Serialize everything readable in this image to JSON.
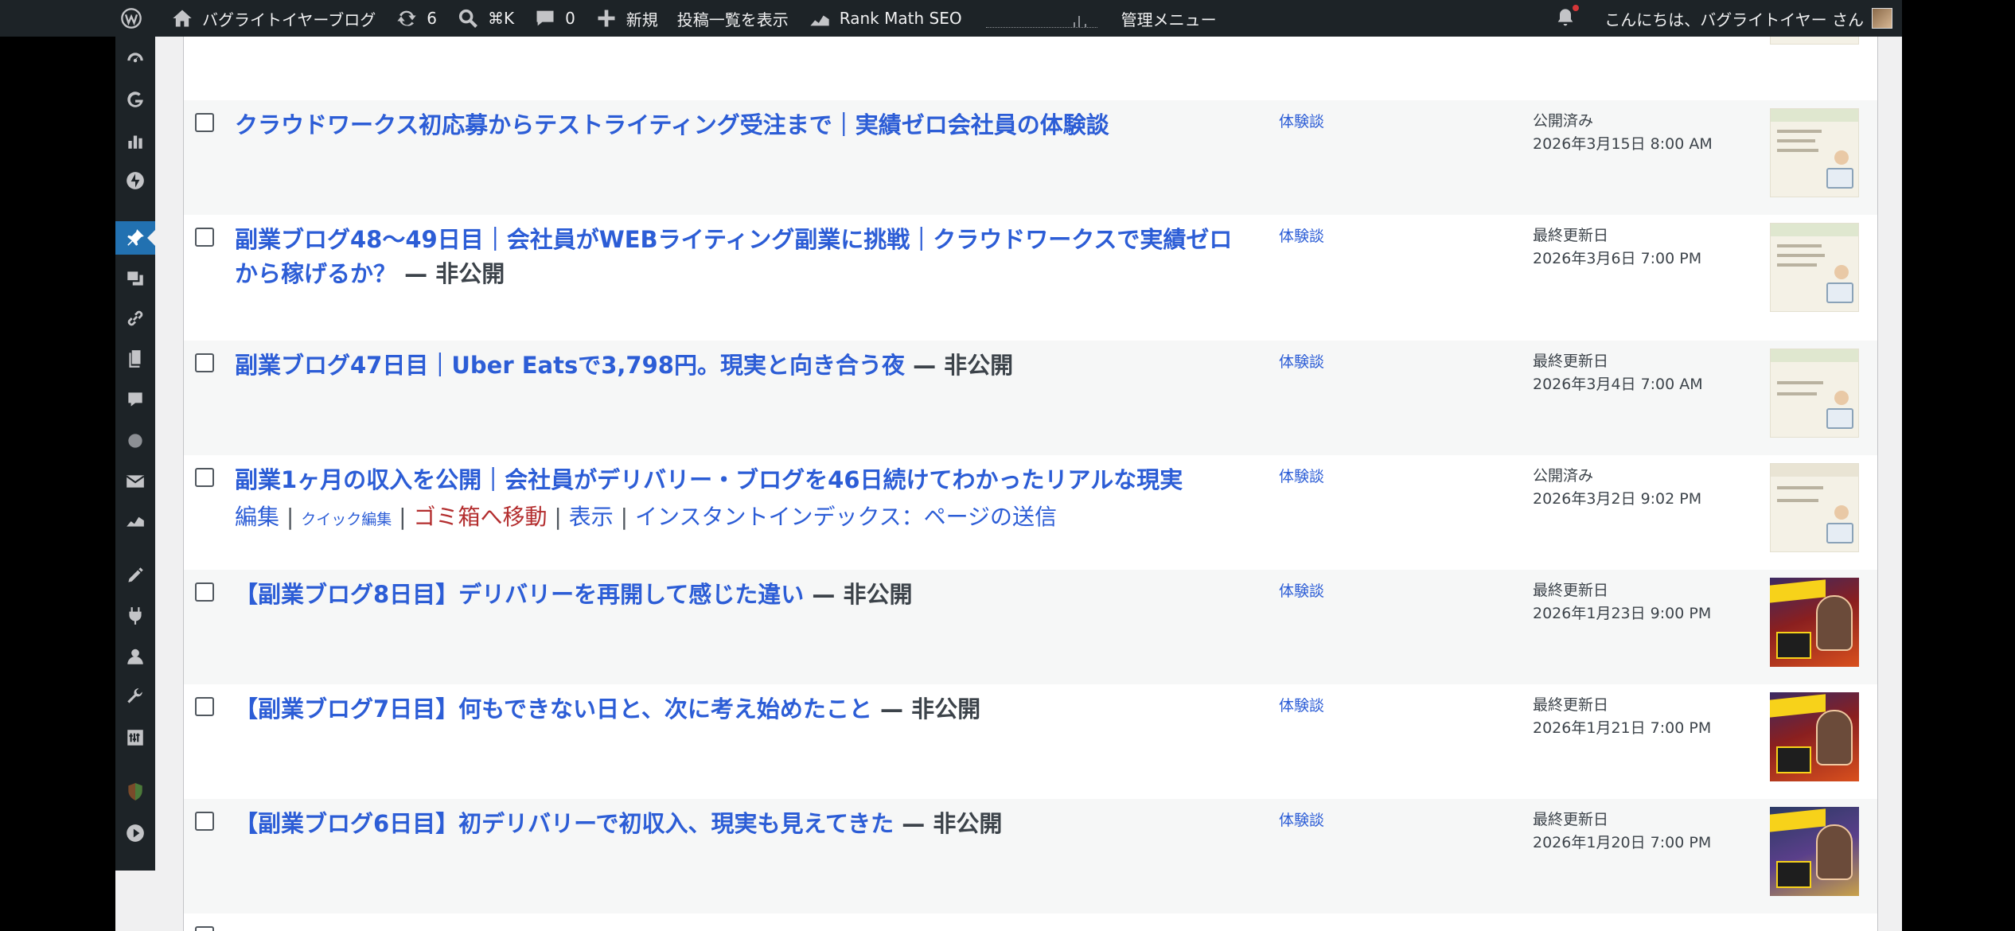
{
  "admin_bar": {
    "site_name": "バグライトイヤーブログ",
    "updates_count": "6",
    "search_shortcut": "⌘K",
    "comments_count": "0",
    "new_label": "新規",
    "view_posts_label": "投稿一覧を表示",
    "rank_math_label": "Rank Math SEO",
    "admin_menu_label": "管理メニュー",
    "greeting": "こんにちは、バグライトイヤー さん"
  },
  "sidebar": {
    "icons": [
      "dashboard-icon",
      "google-icon",
      "analytics-icon",
      "jetpack-icon",
      "posts-icon",
      "media-icon",
      "links-icon",
      "pages-icon",
      "comments-icon",
      "plugin-circle-icon",
      "mail-icon",
      "rank-math-icon",
      "appearance-icon",
      "plugins-icon",
      "users-icon",
      "tools-icon",
      "settings-icon",
      "shield-icon",
      "play-icon"
    ],
    "active": "posts-icon"
  },
  "posts": [
    {
      "title": "クラウドワークス初応募からテストライティング受注まで｜実績ゼロ会社員の体験談",
      "state": "",
      "category": "体験談",
      "status": "公開済み",
      "date": "2026年3月15日 8:00 AM",
      "thumb": "light"
    },
    {
      "title": "副業ブログ48〜49日目｜会社員がWEBライティング副業に挑戦｜クラウドワークスで実績ゼロから稼げるか？",
      "state": " — 非公開",
      "category": "体験談",
      "status": "最終更新日",
      "date": "2026年3月6日 7:00 PM",
      "thumb": "light"
    },
    {
      "title": "副業ブログ47日目｜Uber Eatsで3,798円。現実と向き合う夜",
      "state": " — 非公開",
      "category": "体験談",
      "status": "最終更新日",
      "date": "2026年3月4日 7:00 AM",
      "thumb": "light"
    },
    {
      "title": "副業1ヶ月の収入を公開｜会社員がデリバリー・ブログを46日続けてわかったリアルな現実",
      "state": "",
      "category": "体験談",
      "status": "公開済み",
      "date": "2026年3月2日 9:02 PM",
      "thumb": "light",
      "actions": {
        "edit": "編集",
        "quick_edit": "クイック編集",
        "trash": "ゴミ箱へ移動",
        "view": "表示",
        "instant_index": "インスタントインデックス：ページの送信"
      }
    },
    {
      "title": "【副業ブログ8日目】デリバリーを再開して感じた違い",
      "state": " — 非公開",
      "category": "体験談",
      "status": "最終更新日",
      "date": "2026年1月23日 9:00 PM",
      "thumb": "dark"
    },
    {
      "title": "【副業ブログ7日目】何もできない日と、次に考え始めたこと",
      "state": " — 非公開",
      "category": "体験談",
      "status": "最終更新日",
      "date": "2026年1月21日 7:00 PM",
      "thumb": "dark"
    },
    {
      "title": "【副業ブログ6日目】初デリバリーで初収入、現実も見えてきた",
      "state": " — 非公開",
      "category": "体験談",
      "status": "最終更新日",
      "date": "2026年1月20日 7:00 PM",
      "thumb": "dark"
    }
  ],
  "colors": {
    "link": "#2c5dd6",
    "admin_bar": "#1d2327",
    "active_menu": "#2271b1",
    "trash": "#b32d2e"
  }
}
